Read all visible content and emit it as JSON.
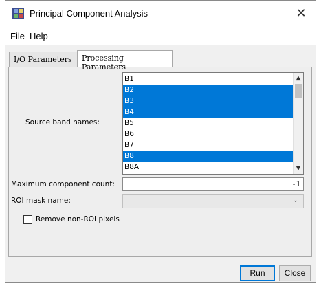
{
  "window": {
    "title": "Principal Component Analysis",
    "close_glyph": "✕"
  },
  "menu": {
    "items": [
      "File",
      "Help"
    ]
  },
  "tabs": [
    {
      "label": "I/O Parameters",
      "active": false
    },
    {
      "label": "Processing Parameters",
      "active": true
    }
  ],
  "form": {
    "source_band_label": "Source band names:",
    "bands": [
      {
        "name": "B1",
        "selected": false
      },
      {
        "name": "B2",
        "selected": true
      },
      {
        "name": "B3",
        "selected": true
      },
      {
        "name": "B4",
        "selected": true
      },
      {
        "name": "B5",
        "selected": false
      },
      {
        "name": "B6",
        "selected": false
      },
      {
        "name": "B7",
        "selected": false
      },
      {
        "name": "B8",
        "selected": true
      },
      {
        "name": "B8A",
        "selected": false
      }
    ],
    "max_component_label": "Maximum component count:",
    "max_component_value": "-1",
    "roi_mask_label": "ROI mask name:",
    "roi_mask_value": "",
    "remove_non_roi_label": "Remove non-ROI pixels",
    "remove_non_roi_checked": false
  },
  "buttons": {
    "run": "Run",
    "close": "Close"
  },
  "colors": {
    "selection": "#0078d7",
    "window_bg": "#f0f0f0"
  },
  "icons": {
    "app": "pca-app-icon",
    "scroll_up": "chevron-up-icon",
    "scroll_down": "chevron-down-icon",
    "dropdown": "chevron-down-icon"
  }
}
